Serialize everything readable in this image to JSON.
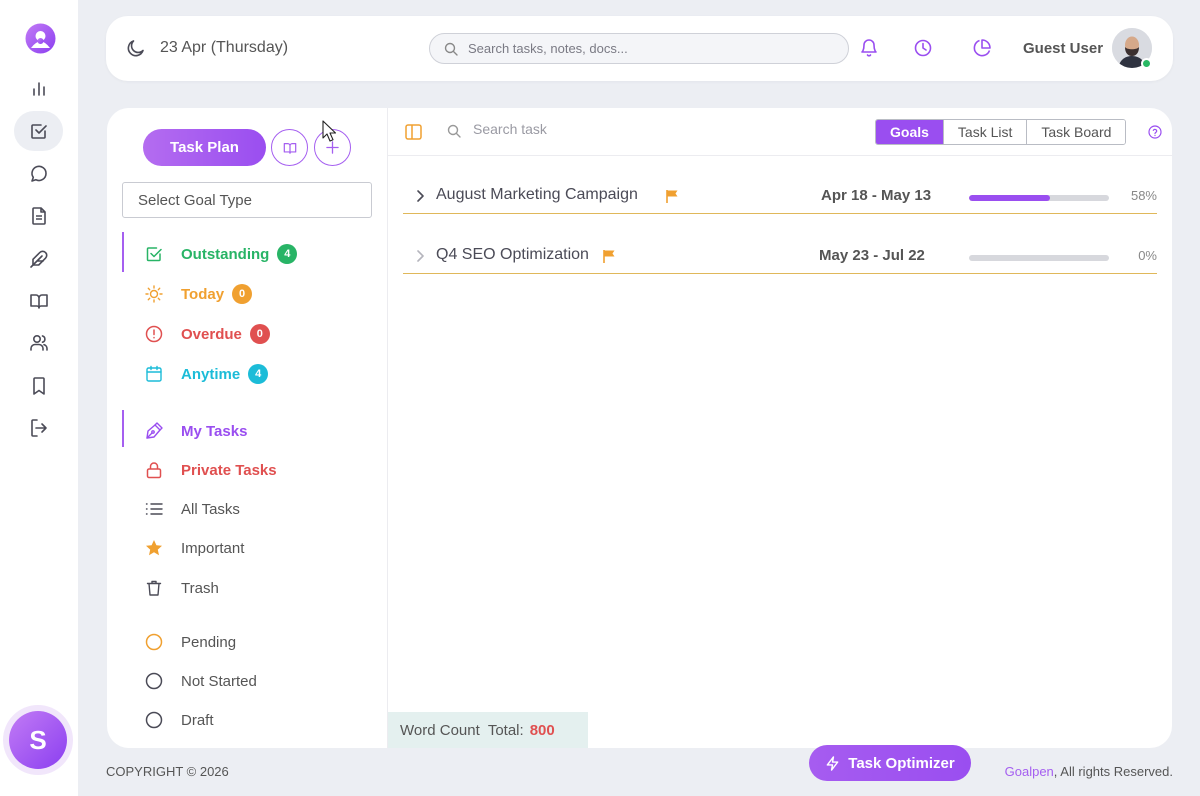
{
  "colors": {
    "accent": "#9a4ef0",
    "green": "#28b466",
    "orange": "#f0a030",
    "red": "#e05050",
    "cyan": "#1cbcd8",
    "gold": "#e0b85a"
  },
  "header": {
    "date": "23 Apr (Thursday)",
    "search_placeholder": "Search tasks, notes, docs...",
    "user_name": "Guest User"
  },
  "sidebar": {
    "task_plan_label": "Task Plan",
    "goal_type_placeholder": "Select Goal Type",
    "status_items": [
      {
        "label": "Outstanding",
        "count": "4",
        "icon": "checkbox-icon"
      },
      {
        "label": "Today",
        "count": "0",
        "icon": "sun-icon"
      },
      {
        "label": "Overdue",
        "count": "0",
        "icon": "alert-icon"
      },
      {
        "label": "Anytime",
        "count": "4",
        "icon": "calendar-icon"
      }
    ],
    "task_items": [
      {
        "label": "My Tasks",
        "icon": "pen-icon"
      },
      {
        "label": "Private Tasks",
        "icon": "lock-icon"
      },
      {
        "label": "All Tasks",
        "icon": "list-icon"
      },
      {
        "label": "Important",
        "icon": "star-icon"
      },
      {
        "label": "Trash",
        "icon": "trash-icon"
      }
    ],
    "state_items": [
      {
        "label": "Pending"
      },
      {
        "label": "Not Started"
      },
      {
        "label": "Draft"
      }
    ]
  },
  "toolbar": {
    "search_placeholder": "Search task",
    "tabs": [
      "Goals",
      "Task List",
      "Task Board"
    ],
    "active_tab": "Goals"
  },
  "goals": [
    {
      "name": "August Marketing Campaign",
      "range": "Apr 18 - May 13",
      "progress": 58,
      "progress_label": "58%"
    },
    {
      "name": "Q4 SEO Optimization",
      "range": "May 23 - Jul 22",
      "progress": 0,
      "progress_label": "0%"
    }
  ],
  "word_count": {
    "label": "Word Count  Total:",
    "value": "800"
  },
  "footer": {
    "copyright": "COPYRIGHT © 2026",
    "optimizer_label": "Task Optimizer",
    "brand": "Goalpen",
    "rights": ", All rights Reserved."
  },
  "rail": {
    "badge_letter": "S"
  }
}
